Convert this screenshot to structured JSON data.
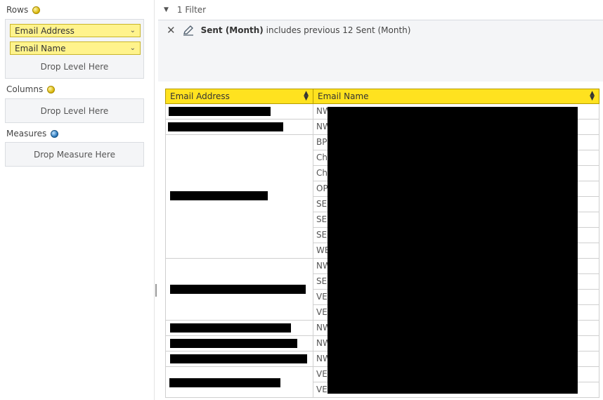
{
  "rows_section": {
    "label": "Rows",
    "items": [
      {
        "label": "Email Address"
      },
      {
        "label": "Email Name"
      }
    ],
    "drop_text": "Drop Level Here"
  },
  "columns_section": {
    "label": "Columns",
    "drop_text": "Drop Level Here"
  },
  "measures_section": {
    "label": "Measures",
    "drop_text": "Drop Measure Here"
  },
  "filter": {
    "summary": "1 Filter",
    "field": "Sent (Month)",
    "description": "includes previous 12 Sent (Month)"
  },
  "grid": {
    "headers": [
      "Email Address",
      "Email Name"
    ],
    "name_prefixes": [
      "NW",
      "NW",
      "BP",
      "Ch",
      "Ch",
      "OP",
      "SE",
      "SE",
      "SE",
      "WE",
      "NW",
      "SE",
      "VE",
      "VE",
      "NW",
      "NW",
      "NW",
      "VE",
      "VE"
    ]
  },
  "colors": {
    "header_yellow": "#ffe21f",
    "pill_yellow": "#fff38c",
    "redaction": "#000000"
  },
  "icons": [
    "collapse-triangle-icon",
    "remove-x-icon",
    "edit-pencil-icon",
    "sort-icon",
    "chevron-down-icon"
  ]
}
